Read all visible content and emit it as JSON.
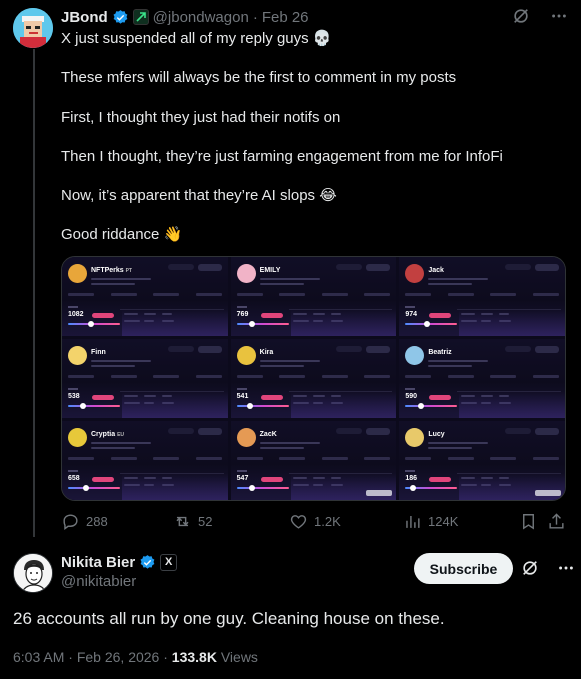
{
  "tweet": {
    "author_name": "JBond",
    "author_handle": "@jbondwagon",
    "separator": "·",
    "date": "Feb 26",
    "lines": [
      "X just suspended all of my reply guys 💀",
      "These mfers will always be the first to comment in my posts",
      "First, I thought they just had their notifs on",
      "Then I thought, they’re just farming engagement from me for InfoFi",
      "Now, it’s apparent that they’re AI slops 😂",
      "Good riddance 👋"
    ],
    "media_cards": [
      {
        "name": "NFTPerks",
        "suffix": "PT",
        "score": "1082",
        "color": "#e8a63a",
        "knob": 0.45
      },
      {
        "name": "EMILY",
        "suffix": "",
        "score": "769",
        "color": "#f1b3c7",
        "knob": 0.3
      },
      {
        "name": "Jack",
        "suffix": "",
        "score": "974",
        "color": "#c24040",
        "knob": 0.42
      },
      {
        "name": "Finn",
        "suffix": "",
        "score": "538",
        "color": "#f3d36b",
        "knob": 0.28
      },
      {
        "name": "Kira",
        "suffix": "",
        "score": "541",
        "color": "#e9c23e",
        "knob": 0.26
      },
      {
        "name": "Beatriz",
        "suffix": "",
        "score": "590",
        "color": "#8fc6e8",
        "knob": 0.3
      },
      {
        "name": "Cryptia",
        "suffix": "EU",
        "score": "658",
        "color": "#e7c83a",
        "knob": 0.35
      },
      {
        "name": "ZacK",
        "suffix": "",
        "score": "547",
        "color": "#e59a54",
        "knob": 0.3
      },
      {
        "name": "Lucy",
        "suffix": "",
        "score": "186",
        "color": "#e8c96a",
        "knob": 0.15
      }
    ],
    "actions": {
      "replies": "288",
      "reposts": "52",
      "likes": "1.2K",
      "views": "124K"
    }
  },
  "reply": {
    "author_name": "Nikita Bier",
    "author_handle": "@nikitabier",
    "affiliate_label": "X",
    "subscribe_label": "Subscribe",
    "text": "26 accounts all run by one guy. Cleaning house on these.",
    "time": "6:03 AM",
    "separator": "·",
    "date": "Feb 26, 2026",
    "separator2": "·",
    "views_count": "133.8K",
    "views_label": "Views"
  },
  "colors": {
    "background": "#000000",
    "text": "#e7e9ea",
    "muted": "#71767b",
    "verified": "#1d9bf0",
    "accent_pink": "#e0457b"
  },
  "icons": {
    "grok": "grok-icon",
    "more": "more-icon",
    "reply": "reply-icon",
    "repost": "repost-icon",
    "like": "like-icon",
    "views": "views-icon",
    "bookmark": "bookmark-icon",
    "share": "share-icon"
  }
}
